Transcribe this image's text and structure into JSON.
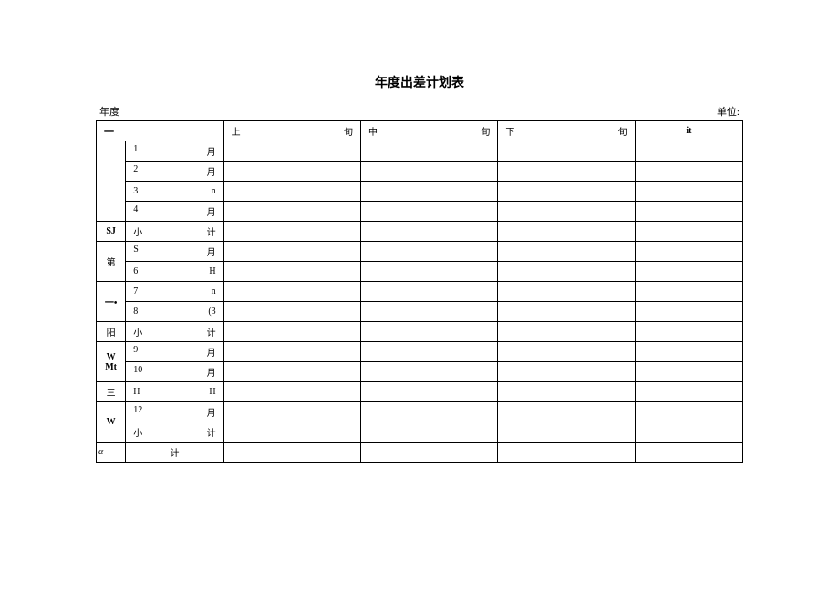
{
  "title": "年度出差计划表",
  "meta": {
    "year_label": "年度",
    "unit_label": "单位:"
  },
  "header": {
    "blank": "一",
    "c1a": "上",
    "c1b": "旬",
    "c2a": "中",
    "c2b": "旬",
    "c3a": "下",
    "c3b": "旬",
    "total": "it"
  },
  "groups": {
    "g1": "",
    "g2": "SJ",
    "g3": "第",
    "g4": "一•",
    "g5": "阳",
    "g6a": "W",
    "g6b": "Mt",
    "g7": "三",
    "g8": "W"
  },
  "rows": {
    "r1": {
      "a": "1",
      "b": "月"
    },
    "r2": {
      "a": "2",
      "b": "月"
    },
    "r3": {
      "a": "3",
      "b": "n",
      "it": true
    },
    "r4": {
      "a": "4",
      "b": "月"
    },
    "r5": {
      "a": "小",
      "b": "计"
    },
    "r6": {
      "a": "S",
      "b": "月"
    },
    "r7": {
      "a": "6",
      "b": "H",
      "it": true
    },
    "r8": {
      "a": "7",
      "b": "n",
      "it": true
    },
    "r9": {
      "a": "8",
      "b": "(3",
      "it": true
    },
    "r10": {
      "a": "小",
      "b": "计"
    },
    "r11": {
      "a": "9",
      "b": "月"
    },
    "r12": {
      "a": "10",
      "b": "月"
    },
    "r13": {
      "a": "H",
      "b": "H",
      "it": true
    },
    "r14": {
      "a": "12",
      "b": "月"
    },
    "r15": {
      "a": "小",
      "b": "计"
    }
  },
  "footer": {
    "alpha": "α",
    "total": "计"
  }
}
